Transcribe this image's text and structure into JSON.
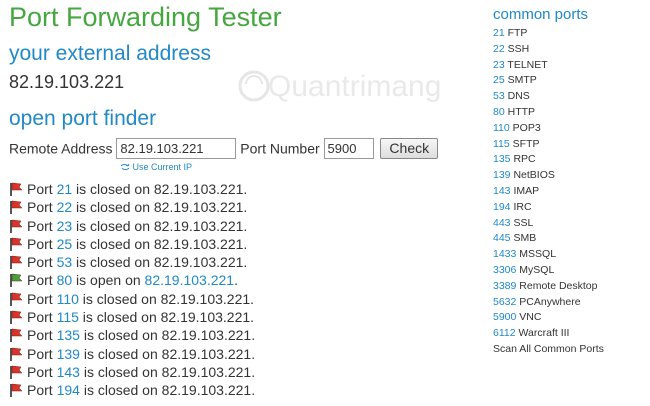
{
  "header": {
    "title": "Port Forwarding Tester",
    "external_heading": "your external address",
    "external_ip": "82.19.103.221",
    "finder_heading": "open port finder"
  },
  "form": {
    "remote_label": "Remote Address",
    "remote_value": "82.19.103.221",
    "port_label": "Port Number",
    "port_value": "5900",
    "check_label": "Check",
    "use_current_ip": "Use Current IP"
  },
  "results": [
    {
      "prefix": "Port ",
      "port": "21",
      "mid": " is closed on ",
      "ip": "82.19.103.221",
      "end": ".",
      "status": "closed"
    },
    {
      "prefix": "Port ",
      "port": "22",
      "mid": " is closed on ",
      "ip": "82.19.103.221",
      "end": ".",
      "status": "closed"
    },
    {
      "prefix": "Port ",
      "port": "23",
      "mid": " is closed on ",
      "ip": "82.19.103.221",
      "end": ".",
      "status": "closed"
    },
    {
      "prefix": "Port ",
      "port": "25",
      "mid": " is closed on ",
      "ip": "82.19.103.221",
      "end": ".",
      "status": "closed"
    },
    {
      "prefix": "Port ",
      "port": "53",
      "mid": " is closed on ",
      "ip": "82.19.103.221",
      "end": ".",
      "status": "closed"
    },
    {
      "prefix": "Port ",
      "port": "80",
      "mid": " is open on ",
      "ip": "82.19.103.221",
      "end": ".",
      "status": "open"
    },
    {
      "prefix": "Port ",
      "port": "110",
      "mid": " is closed on ",
      "ip": "82.19.103.221",
      "end": ".",
      "status": "closed"
    },
    {
      "prefix": "Port ",
      "port": "115",
      "mid": " is closed on ",
      "ip": "82.19.103.221",
      "end": ".",
      "status": "closed"
    },
    {
      "prefix": "Port ",
      "port": "135",
      "mid": " is closed on ",
      "ip": "82.19.103.221",
      "end": ".",
      "status": "closed"
    },
    {
      "prefix": "Port ",
      "port": "139",
      "mid": " is closed on ",
      "ip": "82.19.103.221",
      "end": ".",
      "status": "closed"
    },
    {
      "prefix": "Port ",
      "port": "143",
      "mid": " is closed on ",
      "ip": "82.19.103.221",
      "end": ".",
      "status": "closed"
    },
    {
      "prefix": "Port ",
      "port": "194",
      "mid": " is closed on ",
      "ip": "82.19.103.221",
      "end": ".",
      "status": "closed"
    }
  ],
  "sidebar": {
    "heading": "common ports",
    "items": [
      {
        "num": "21",
        "name": " FTP"
      },
      {
        "num": "22",
        "name": " SSH"
      },
      {
        "num": "23",
        "name": " TELNET"
      },
      {
        "num": "25",
        "name": " SMTP"
      },
      {
        "num": "53",
        "name": " DNS"
      },
      {
        "num": "80",
        "name": " HTTP"
      },
      {
        "num": "110",
        "name": " POP3"
      },
      {
        "num": "115",
        "name": " SFTP"
      },
      {
        "num": "135",
        "name": " RPC"
      },
      {
        "num": "139",
        "name": " NetBIOS"
      },
      {
        "num": "143",
        "name": " IMAP"
      },
      {
        "num": "194",
        "name": " IRC"
      },
      {
        "num": "443",
        "name": " SSL"
      },
      {
        "num": "445",
        "name": " SMB"
      },
      {
        "num": "1433",
        "name": " MSSQL"
      },
      {
        "num": "3306",
        "name": " MySQL"
      },
      {
        "num": "3389",
        "name": " Remote Desktop"
      },
      {
        "num": "5632",
        "name": " PCAnywhere"
      },
      {
        "num": "5900",
        "name": " VNC"
      },
      {
        "num": "6112",
        "name": " Warcraft III"
      }
    ],
    "scan_all": "Scan All Common Ports"
  },
  "watermark": "Quantrimang",
  "colors": {
    "title_green": "#45a73f",
    "link_blue": "#2189c6",
    "closed_red": "#d9342b",
    "open_green": "#3fa53a"
  },
  "icons": {
    "closed": "red-flag-icon",
    "open": "green-flag-icon",
    "refresh": "refresh-icon"
  }
}
